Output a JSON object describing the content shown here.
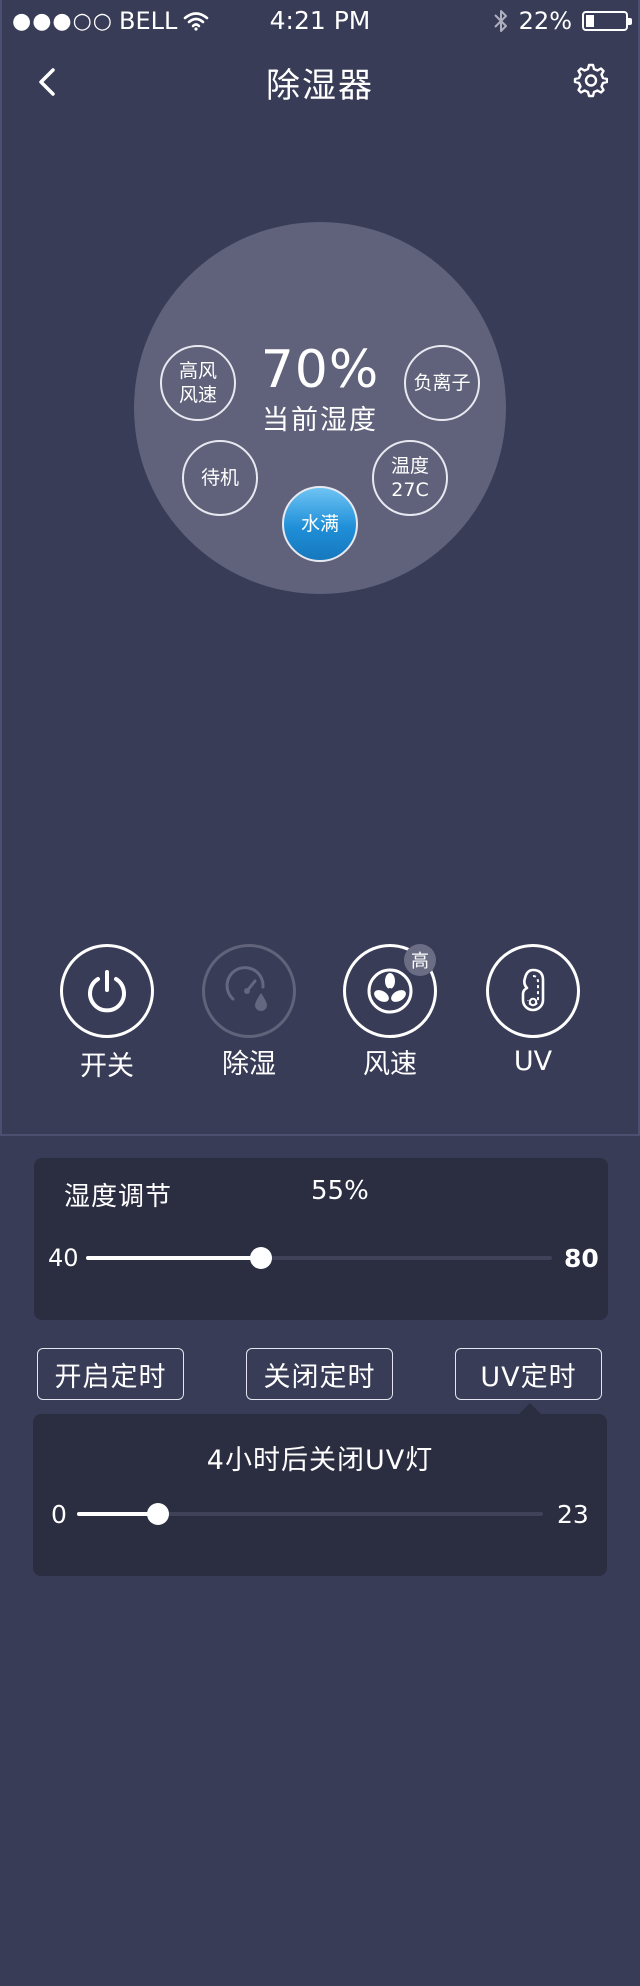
{
  "status_bar": {
    "signal_dots": "●●●○○",
    "carrier": "BELL",
    "time": "4:21 PM",
    "battery_percent": "22%",
    "battery_level": 0.22
  },
  "nav": {
    "title": "除湿器"
  },
  "dashboard": {
    "humidity_value": "70%",
    "humidity_label": "当前湿度",
    "bubbles": {
      "fan_speed_line1": "高风",
      "fan_speed_line2": "风速",
      "negative_ion": "负离子",
      "standby": "待机",
      "temperature_line1": "温度",
      "temperature_line2": "27C",
      "water_full": "水满"
    }
  },
  "controls": {
    "power_label": "开关",
    "dehumidify_label": "除湿",
    "fan_label": "风速",
    "fan_badge": "高",
    "uv_label": "UV"
  },
  "humidity_adjust": {
    "title": "湿度调节",
    "value": "55%",
    "min": "40",
    "max": "80",
    "current": 55,
    "range": [
      40,
      80
    ]
  },
  "timers": {
    "on_timer": "开启定时",
    "off_timer": "关闭定时",
    "uv_timer": "UV定时"
  },
  "uv_timer_panel": {
    "message": "4小时后关闭UV灯",
    "min": "0",
    "max": "23",
    "current": 4,
    "range": [
      0,
      23
    ]
  }
}
